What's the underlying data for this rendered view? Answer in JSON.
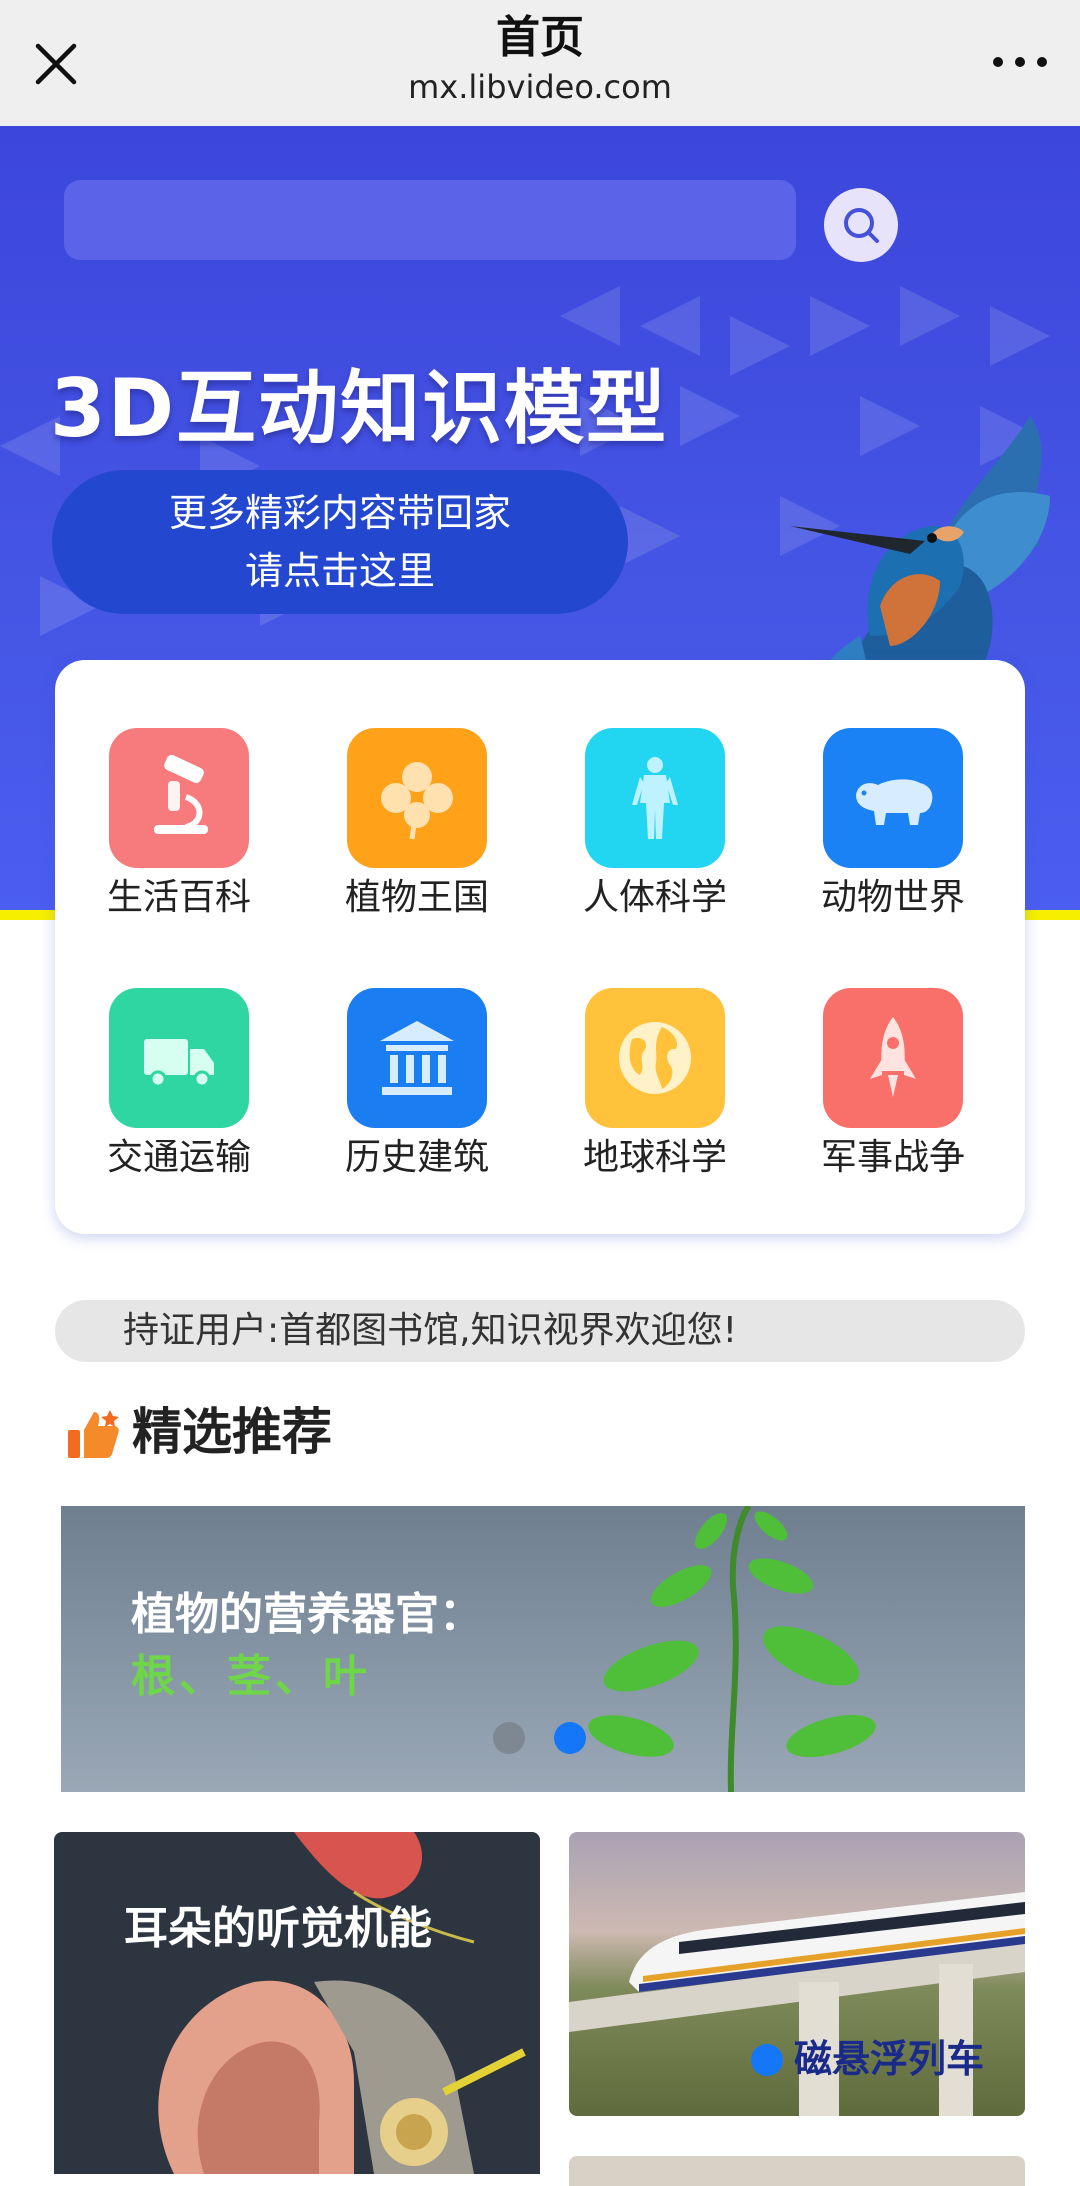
{
  "browser": {
    "title": "首页",
    "url": "mx.libvideo.com",
    "close_icon": "close-icon",
    "more_icon": "more-dots-icon"
  },
  "hero": {
    "search_placeholder": "",
    "title": "3D互动知识模型",
    "cta_line1": "更多精彩内容带回家",
    "cta_line2": "请点击这里"
  },
  "categories": [
    {
      "label": "生活百科",
      "icon": "microscope-icon",
      "color": "#f77a7c"
    },
    {
      "label": "植物王国",
      "icon": "clover-icon",
      "color": "#ffa21a"
    },
    {
      "label": "人体科学",
      "icon": "human-body-icon",
      "color": "#22d6f2"
    },
    {
      "label": "动物世界",
      "icon": "bear-icon",
      "color": "#1a82f5"
    },
    {
      "label": "交通运输",
      "icon": "truck-icon",
      "color": "#2fd6a2"
    },
    {
      "label": "历史建筑",
      "icon": "building-icon",
      "color": "#1a7df2"
    },
    {
      "label": "地球科学",
      "icon": "globe-icon",
      "color": "#ffc23a"
    },
    {
      "label": "军事战争",
      "icon": "rocket-icon",
      "color": "#f9706a"
    }
  ],
  "notice": "持证用户:首都图书馆,知识视界欢迎您!",
  "section": {
    "title": "精选推荐",
    "icon": "thumbs-up-icon"
  },
  "banner": {
    "line1": "植物的营养器官：",
    "line2": "根、茎、叶",
    "slides": 2,
    "active_slide": 2
  },
  "cards": [
    {
      "title": "耳朵的听觉机能"
    },
    {
      "title": "磁悬浮列车"
    }
  ]
}
